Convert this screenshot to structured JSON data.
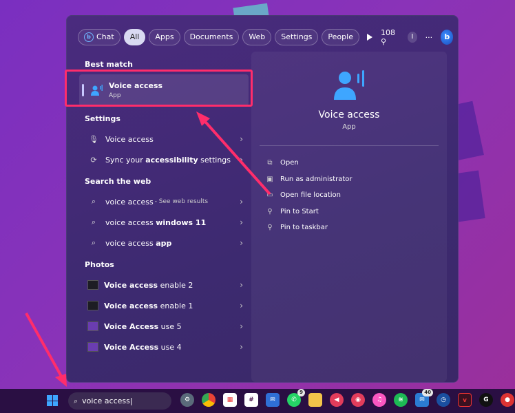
{
  "tabs": [
    {
      "label": "Chat",
      "icon": "bing-icon"
    },
    {
      "label": "All",
      "active": true
    },
    {
      "label": "Apps"
    },
    {
      "label": "Documents"
    },
    {
      "label": "Web"
    },
    {
      "label": "Settings"
    },
    {
      "label": "People"
    }
  ],
  "header_right": {
    "points": "108",
    "avatar_letter": "I",
    "more": "···"
  },
  "sections": {
    "best_match": "Best match",
    "settings": "Settings",
    "search_web": "Search the web",
    "photos": "Photos"
  },
  "best_match": {
    "title": "Voice access",
    "subtitle": "App"
  },
  "settings_items": [
    {
      "label": "Voice access",
      "icon": "mic-icon"
    },
    {
      "label_pre": "Sync your ",
      "label_bold": "accessibility",
      "label_post": " settings",
      "icon": "sync-icon"
    }
  ],
  "web_items": [
    {
      "label": "voice access",
      "hint": " - See web results"
    },
    {
      "label": "voice access ",
      "bold": "windows 11"
    },
    {
      "label": "voice access ",
      "bold": "app"
    }
  ],
  "photo_items": [
    {
      "label": "Voice access ",
      "rest": "enable 2"
    },
    {
      "label": "Voice access ",
      "rest": "enable 1"
    },
    {
      "label": "Voice Access ",
      "rest": "use 5"
    },
    {
      "label": "Voice Access ",
      "rest": "use 4"
    }
  ],
  "detail": {
    "title": "Voice access",
    "subtitle": "App",
    "actions": [
      {
        "label": "Open",
        "icon": "open-icon"
      },
      {
        "label": "Run as administrator",
        "icon": "admin-icon"
      },
      {
        "label": "Open file location",
        "icon": "folder-icon"
      },
      {
        "label": "Pin to Start",
        "icon": "pin-icon"
      },
      {
        "label": "Pin to taskbar",
        "icon": "pin-icon"
      }
    ]
  },
  "taskbar": {
    "search_value": "voice access",
    "badges": {
      "whatsapp": "9",
      "mail": "40"
    }
  },
  "colors": {
    "accent_red": "#ff2d6b",
    "app_blue": "#3ea6ff"
  }
}
